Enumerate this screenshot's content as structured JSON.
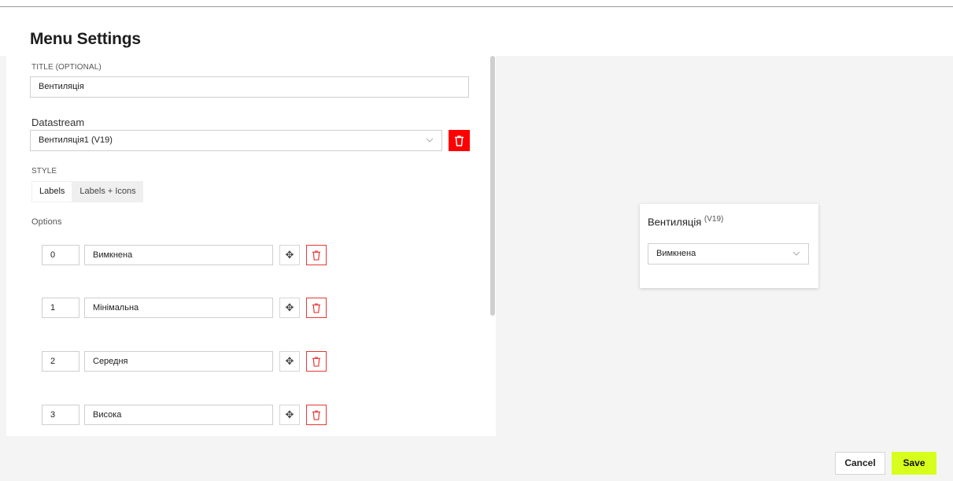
{
  "modal": {
    "title": "Menu Settings"
  },
  "form": {
    "title_label": "TITLE (OPTIONAL)",
    "title_value": "Вентиляція",
    "datastream_label": "Datastream",
    "datastream_value": "Вентиляція1 (V19)",
    "style_label": "STYLE",
    "style_options": [
      "Labels",
      "Labels + Icons"
    ],
    "style_selected": "Labels",
    "options_label": "Options",
    "options": [
      {
        "value": "0",
        "label": "Вимкнена"
      },
      {
        "value": "1",
        "label": "Мінімальна"
      },
      {
        "value": "2",
        "label": "Середня"
      },
      {
        "value": "3",
        "label": "Висока"
      }
    ]
  },
  "preview": {
    "title": "Вентиляція",
    "pin": "(V19)",
    "selected": "Вимкнена"
  },
  "footer": {
    "cancel_label": "Cancel",
    "save_label": "Save"
  },
  "colors": {
    "accent_red": "#ff0000",
    "save_green": "#d7ff1e"
  },
  "icons": {
    "delete": "trash-icon",
    "move": "move-icon",
    "dropdown": "chevron-down-icon"
  }
}
